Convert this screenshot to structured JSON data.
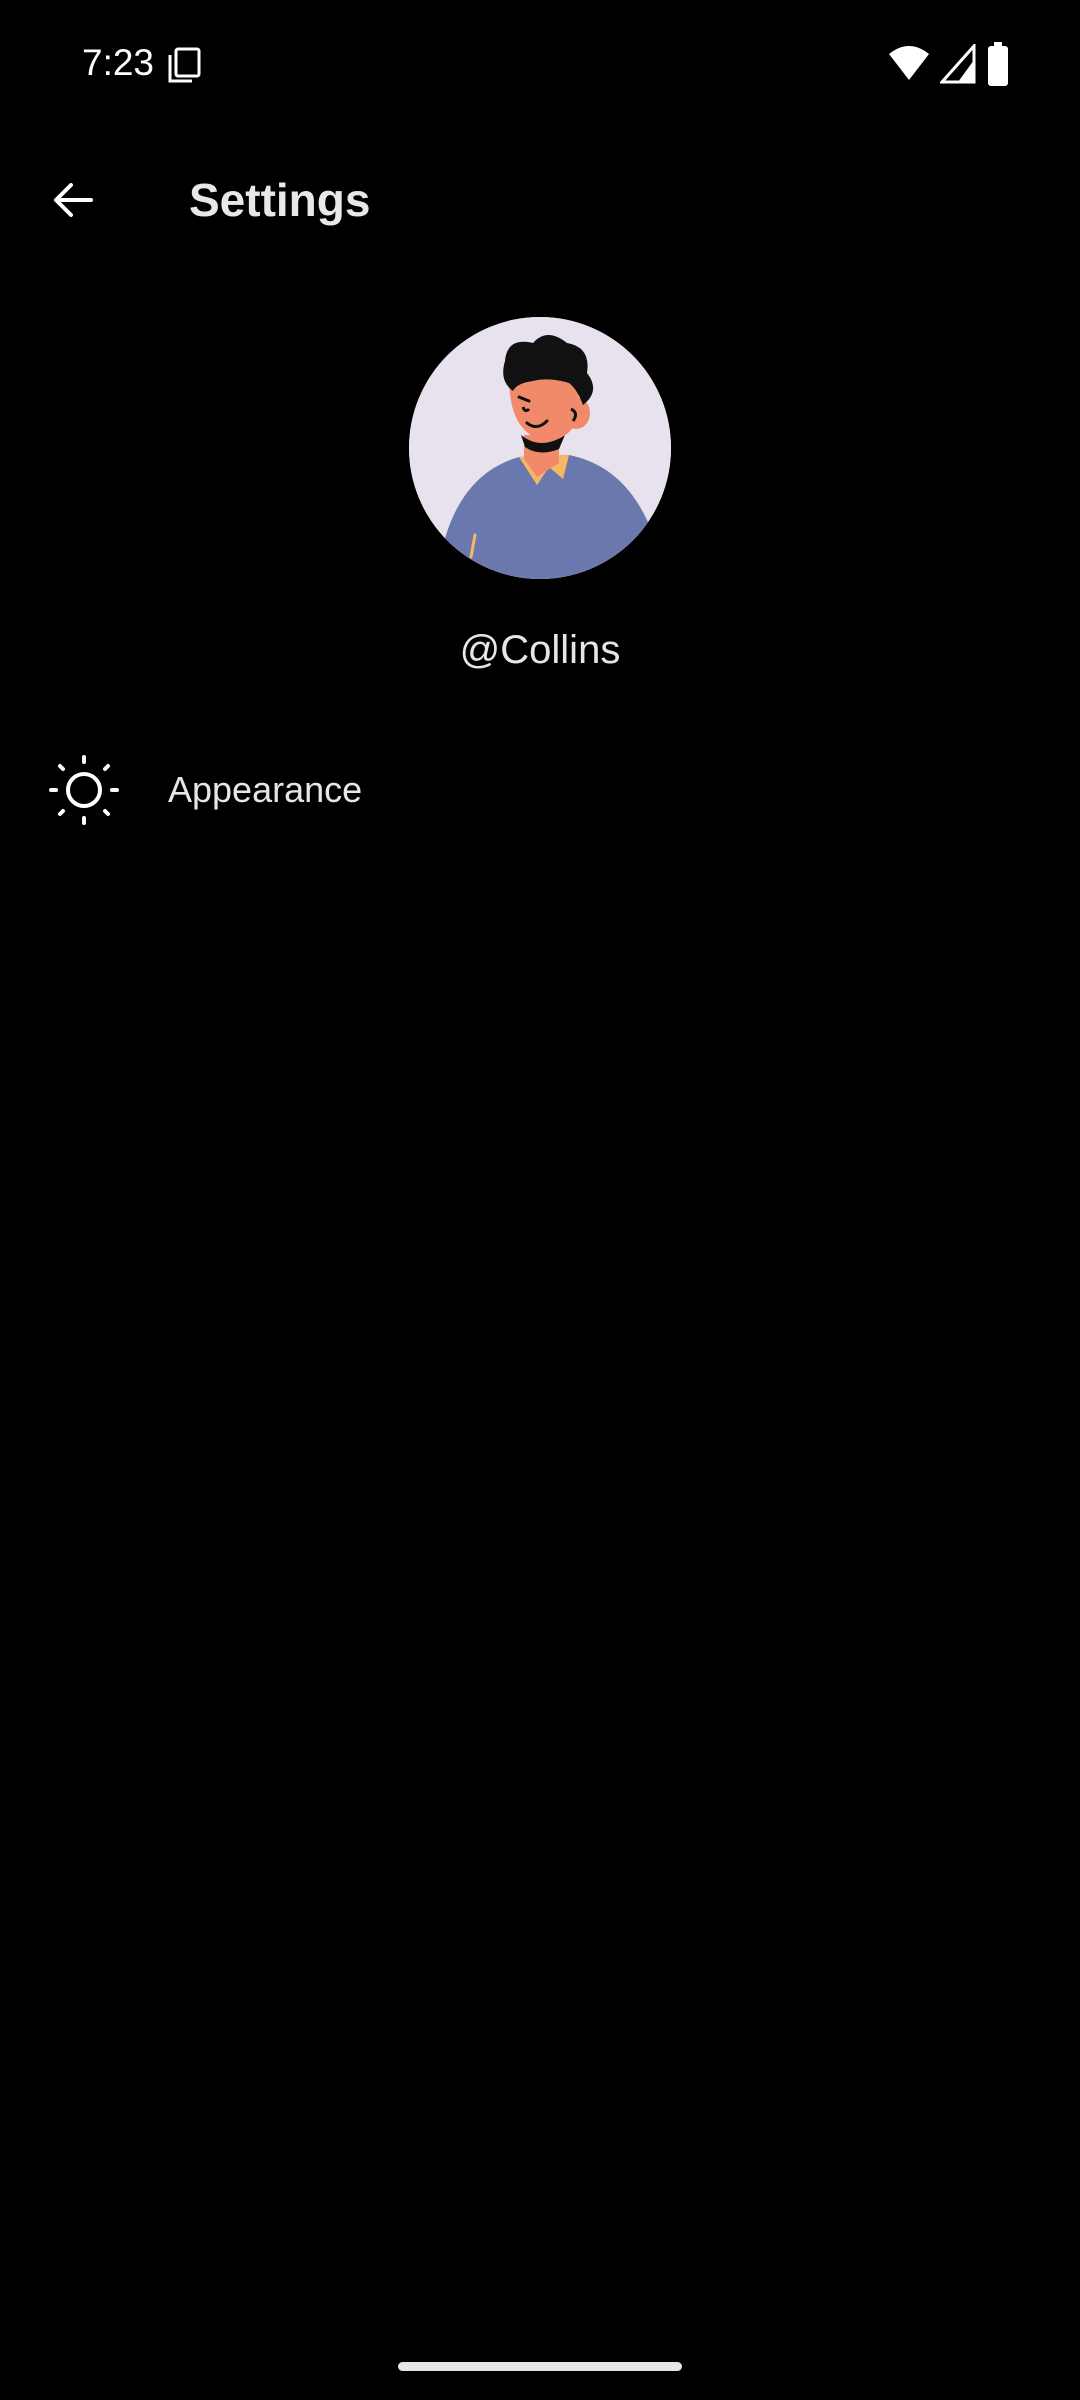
{
  "status_bar": {
    "time": "7:23",
    "icons": [
      "screenshot-icon",
      "wifi-icon",
      "signal-icon",
      "battery-icon"
    ]
  },
  "app_bar": {
    "back_icon": "arrow-left-icon",
    "title": "Settings"
  },
  "profile": {
    "avatar_icon": "avatar-illustration",
    "username": "@Collins"
  },
  "settings_items": [
    {
      "icon": "sun-icon",
      "label": "Appearance"
    }
  ],
  "colors": {
    "background": "#000000",
    "text": "#e6e6e6",
    "avatar_background": "#e8e2ee",
    "avatar_shirt": "#6b78ad",
    "avatar_collar": "#f6b766",
    "avatar_skin": "#f08a6a"
  }
}
